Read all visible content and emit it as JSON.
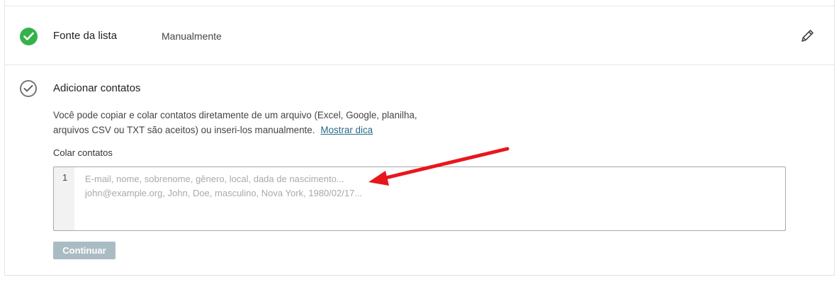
{
  "step_source": {
    "title": "Fonte da lista",
    "value": "Manualmente",
    "status_icon": "check-circle-filled-icon",
    "edit_icon": "pencil-icon",
    "accent": "#34b249"
  },
  "step_add": {
    "title": "Adicionar contatos",
    "status_icon": "check-circle-outline-icon",
    "description_line1": "Você pode copiar e colar contatos diretamente de um arquivo (Excel, Google, planilha,",
    "description_line2": "arquivos CSV ou TXT são aceitos) ou inseri-los manualmente.",
    "tip_link": "Mostrar dica",
    "paste_label": "Colar contatos",
    "editor": {
      "line_number": "1",
      "placeholder_line1": "E-mail, nome, sobrenome, gênero, local, dada de nascimento...",
      "placeholder_line2": "john@example.org, John, Doe, masculino, Nova York, 1980/02/17..."
    },
    "continue_button": "Continuar",
    "button_color": "#a9bcc4"
  },
  "annotation": {
    "shape": "arrow",
    "color": "#e8161b"
  }
}
